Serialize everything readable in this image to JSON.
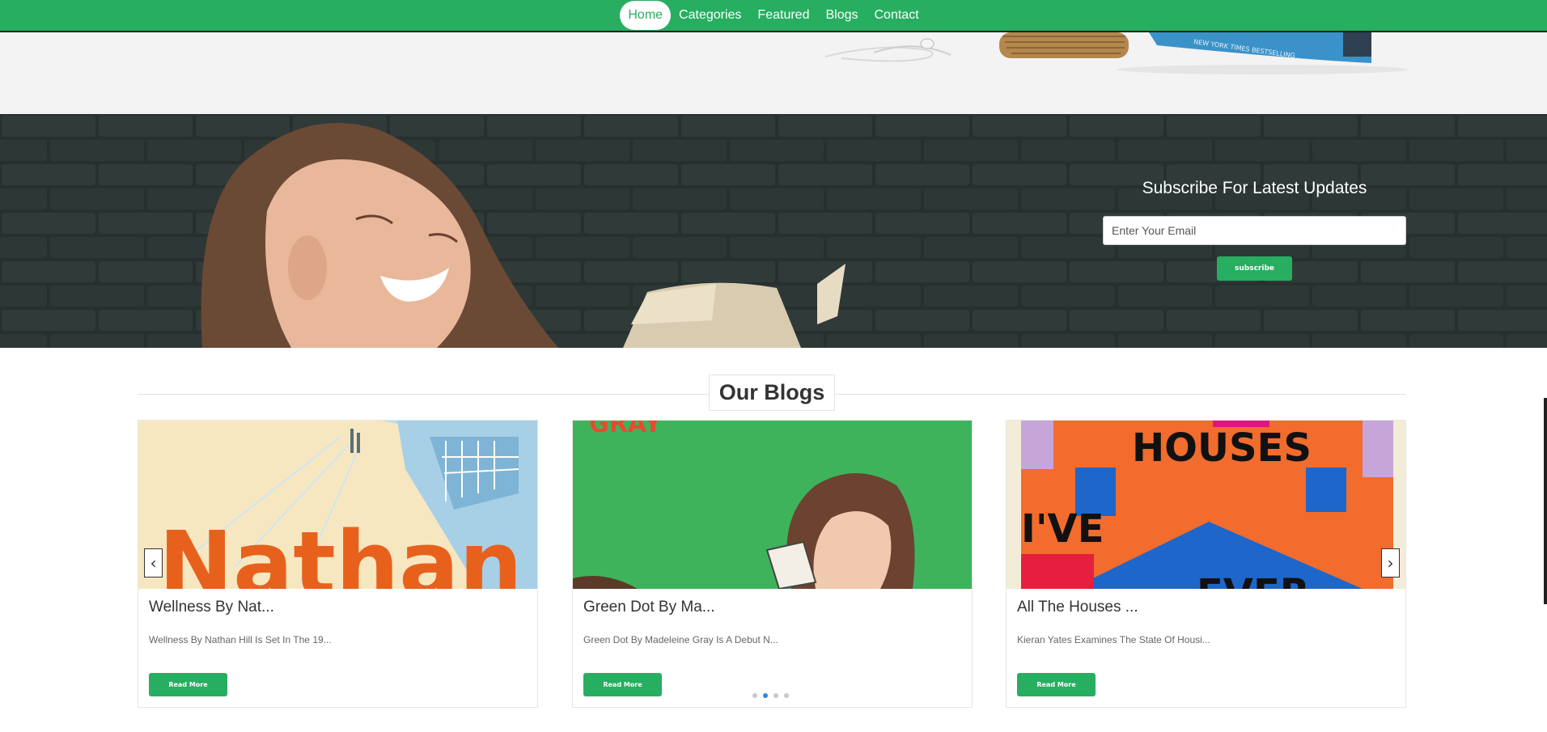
{
  "nav": {
    "items": [
      {
        "label": "Home",
        "active": true
      },
      {
        "label": "Categories"
      },
      {
        "label": "Featured"
      },
      {
        "label": "Blogs"
      },
      {
        "label": "Contact"
      }
    ]
  },
  "hero": {
    "book_text": "NEW YORK TIMES BESTSELLING"
  },
  "subscribe": {
    "title": "Subscribe For Latest Updates",
    "email_placeholder": "Enter Your Email",
    "button_label": "subscribe"
  },
  "blogs": {
    "heading": "Our Blogs",
    "cards": [
      {
        "title": "Wellness By Nat...",
        "description": "Wellness By Nathan Hill Is Set In The 19...",
        "button": "Read More",
        "cover_text": "Nathan"
      },
      {
        "title": "Green Dot By Ma...",
        "description": "Green Dot By Madeleine Gray Is A Debut N...",
        "button": "Read More",
        "cover_text": "GRAY"
      },
      {
        "title": "All The Houses ...",
        "description": "Kieran Yates Examines The State Of Housi...",
        "button": "Read More",
        "cover_text": [
          "HOUSES",
          "I'VE",
          "EVER"
        ]
      }
    ],
    "carousel": {
      "page_count": 4,
      "active_page": 2
    }
  },
  "colors": {
    "brand": "#27ae60",
    "dot_active": "#2f86e0"
  }
}
